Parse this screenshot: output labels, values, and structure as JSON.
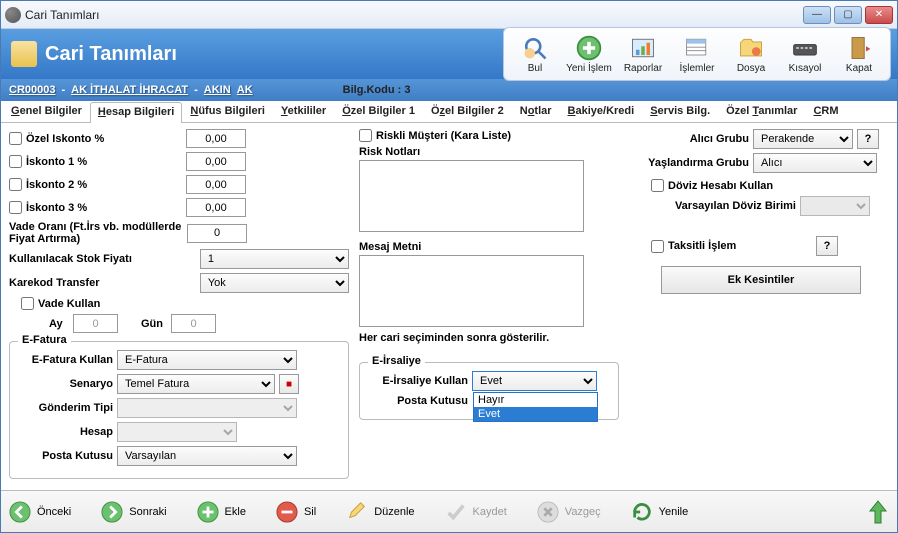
{
  "window": {
    "title": "Cari Tanımları"
  },
  "header": {
    "title": "Cari Tanımları"
  },
  "toolbar": {
    "bul": "Bul",
    "yeni_islem": "Yeni İşlem",
    "raporlar": "Raporlar",
    "islemler": "İşlemler",
    "dosya": "Dosya",
    "kisayol": "Kısayol",
    "kapat": "Kapat"
  },
  "info": {
    "code": "CR00003",
    "name1": "AK İTHALAT İHRACAT",
    "name2": "AKIN",
    "name3": "AK",
    "bilg_kodu_lbl": "Bilg.Kodu :",
    "bilg_kodu_val": "3"
  },
  "tabs": [
    "Genel Bilgiler",
    "Hesap Bilgileri",
    "Nüfus Bilgileri",
    "Yetkililer",
    "Özel Bilgiler 1",
    "Özel Bilgiler 2",
    "Notlar",
    "Bakiye/Kredi",
    "Servis Bilg.",
    "Özel Tanımlar",
    "CRM"
  ],
  "left": {
    "ozel_iskonto": "Özel Iskonto %",
    "iskonto1": "İskonto 1 %",
    "iskonto2": "İskonto 2 %",
    "iskonto3": "İskonto 3 %",
    "ozel_val": "0,00",
    "i1_val": "0,00",
    "i2_val": "0,00",
    "i3_val": "0,00",
    "vade_orani": "Vade Oranı (Ft.İrs vb. modüllerde Fiyat Artırma)",
    "vade_orani_val": "0",
    "stok_fiyati": "Kullanılacak Stok Fiyatı",
    "stok_fiyati_val": "1",
    "karekod": "Karekod Transfer",
    "karekod_val": "Yok",
    "vade_kullan": "Vade Kullan",
    "ay": "Ay",
    "ay_val": "0",
    "gun": "Gün",
    "gun_val": "0"
  },
  "efatura": {
    "legend": "E-Fatura",
    "kullan_lbl": "E-Fatura Kullan",
    "kullan_val": "E-Fatura",
    "senaryo_lbl": "Senaryo",
    "senaryo_val": "Temel Fatura",
    "gonderim_lbl": "Gönderim Tipi",
    "gonderim_val": "",
    "hesap_lbl": "Hesap",
    "hesap_val": "",
    "posta_lbl": "Posta Kutusu",
    "posta_val": "Varsayılan"
  },
  "mid": {
    "riskli": "Riskli Müşteri (Kara Liste)",
    "risk_notlari": "Risk Notları",
    "mesaj_metni": "Mesaj Metni",
    "mesaj_note": "Her cari seçiminden sonra gösterilir."
  },
  "eirsaliye": {
    "legend": "E-İrsaliye",
    "kullan_lbl": "E-İrsaliye Kullan",
    "kullan_val": "Evet",
    "posta_lbl": "Posta Kutusu",
    "dd_hayir": "Hayır",
    "dd_evet": "Evet"
  },
  "right": {
    "alici_grubu_lbl": "Alıcı Grubu",
    "alici_grubu_val": "Perakende",
    "yaslandirma_lbl": "Yaşlandırma Grubu",
    "yaslandirma_val": "Alıcı",
    "doviz_hesabi": "Döviz Hesabı Kullan",
    "vars_doviz": "Varsayılan Döviz Birimi",
    "taksitli": "Taksitli İşlem",
    "ek_kesintiler": "Ek Kesintiler",
    "q": "?"
  },
  "footer": {
    "onceki": "Önceki",
    "sonraki": "Sonraki",
    "ekle": "Ekle",
    "sil": "Sil",
    "duzenle": "Düzenle",
    "kaydet": "Kaydet",
    "vazgec": "Vazgeç",
    "yenile": "Yenile"
  }
}
